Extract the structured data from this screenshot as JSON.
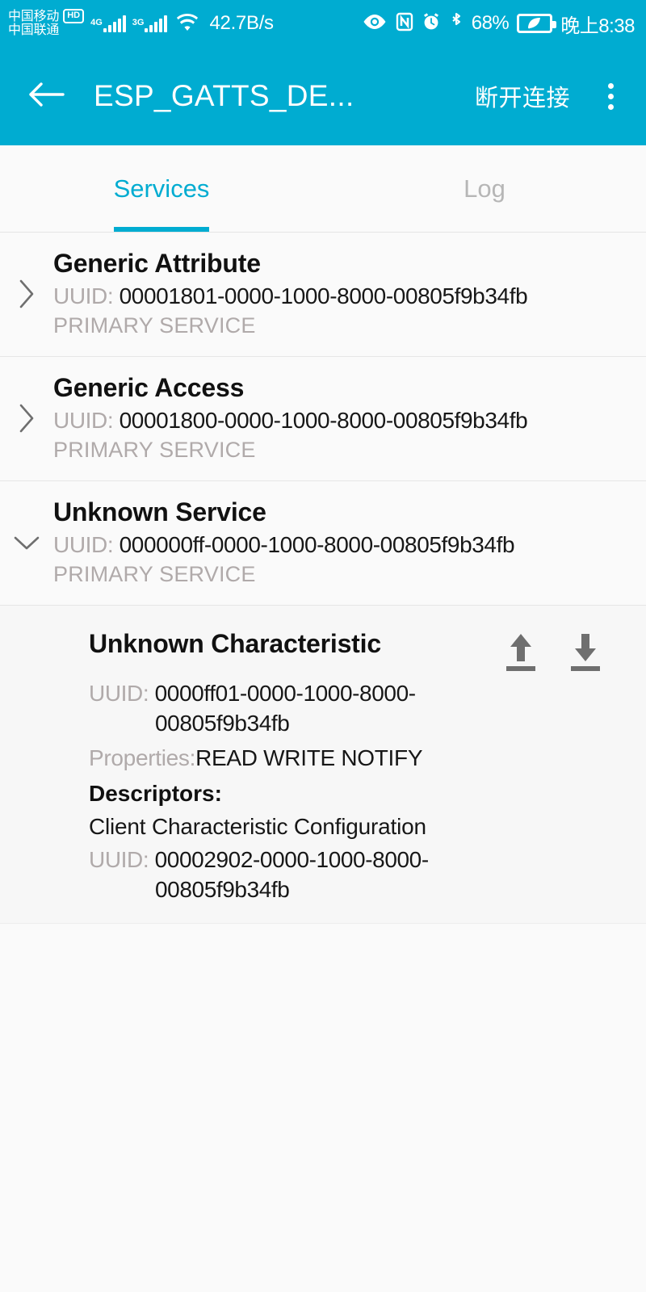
{
  "status_bar": {
    "carrier_primary": "中国移动",
    "carrier_primary_badge": "HD",
    "carrier_secondary": "中国联通",
    "network_1": "4G",
    "network_2": "3G",
    "wifi": "wifi-icon",
    "net_speed": "42.7B/s",
    "eye_icon": "eye-comfort-icon",
    "nfc_icon": "nfc-icon",
    "alarm_icon": "alarm-icon",
    "bluetooth_icon": "bluetooth-icon",
    "battery_percent": "68%",
    "battery_icon": "battery-saver-icon",
    "clock": "晚上8:38"
  },
  "app_bar": {
    "back_icon": "arrow-left-icon",
    "title": "ESP_GATTS_DE...",
    "disconnect_label": "断开连接",
    "overflow_icon": "overflow-menu-icon",
    "background_color": "#00ACD1"
  },
  "tabs": [
    {
      "label": "Services",
      "active": true
    },
    {
      "label": "Log",
      "active": false
    }
  ],
  "colors": {
    "accent": "#00ACD1",
    "page_background": "#FAFAFA",
    "muted_text": "#B0AAAA",
    "primary_text": "#111111"
  },
  "services": [
    {
      "name": "Generic Attribute",
      "uuid_label": "UUID:",
      "uuid": "00001801-0000-1000-8000-00805f9b34fb",
      "type": "PRIMARY SERVICE",
      "expanded": false,
      "chevron": "chevron-right-icon"
    },
    {
      "name": "Generic Access",
      "uuid_label": "UUID:",
      "uuid": "00001800-0000-1000-8000-00805f9b34fb",
      "type": "PRIMARY SERVICE",
      "expanded": false,
      "chevron": "chevron-right-icon"
    },
    {
      "name": "Unknown Service",
      "uuid_label": "UUID:",
      "uuid": "000000ff-0000-1000-8000-00805f9b34fb",
      "type": "PRIMARY SERVICE",
      "expanded": true,
      "chevron": "chevron-down-icon"
    }
  ],
  "characteristic": {
    "name": "Unknown Characteristic",
    "uuid_label": "UUID:",
    "uuid": "0000ff01-0000-1000-8000-00805f9b34fb",
    "properties_label": "Properties:",
    "properties_value": "READ WRITE NOTIFY",
    "write_icon": "upload-arrow-icon",
    "read_icon": "download-arrow-icon",
    "descriptors_title": "Descriptors:",
    "descriptors": [
      {
        "name": "Client Characteristic Configuration",
        "uuid_label": "UUID:",
        "uuid": "00002902-0000-1000-8000-00805f9b34fb"
      }
    ]
  }
}
